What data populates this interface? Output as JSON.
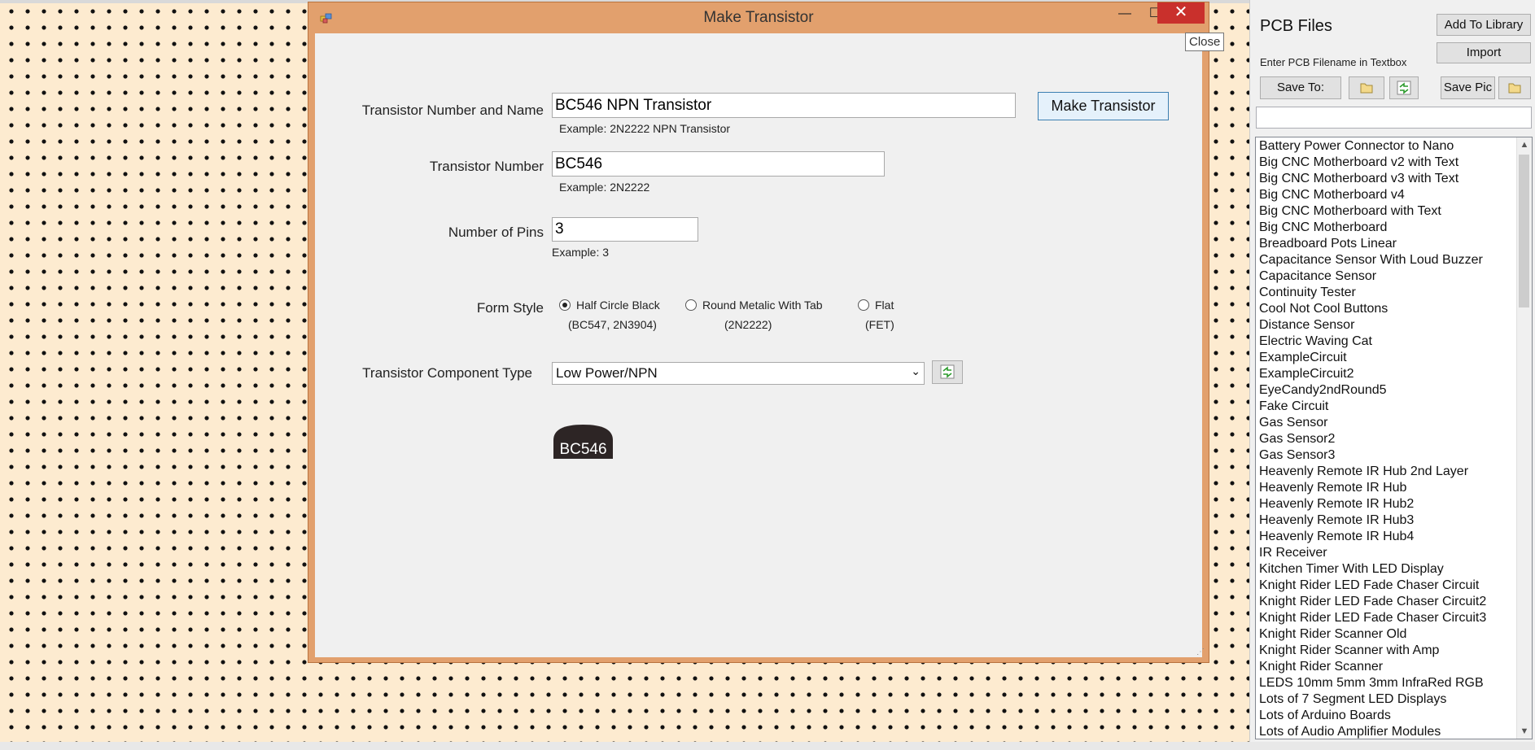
{
  "dialog": {
    "title": "Make Transistor",
    "minimize_glyph": "—",
    "maximize_glyph": "☐",
    "close_glyph": "✕",
    "close_tooltip": "Close",
    "name_label": "Transistor Number and Name",
    "name_value": "BC546 NPN Transistor",
    "name_hint": "Example: 2N2222 NPN Transistor",
    "make_button": "Make Transistor",
    "number_label": "Transistor Number",
    "number_value": "BC546",
    "number_hint": "Example: 2N2222",
    "pins_label": "Number of Pins",
    "pins_value": "3",
    "pins_hint": "Example: 3",
    "form_label": "Form Style",
    "form_options": [
      {
        "label": "Half Circle Black",
        "sub": "(BC547, 2N3904)",
        "selected": true
      },
      {
        "label": "Round Metalic With Tab",
        "sub": "(2N2222)",
        "selected": false
      },
      {
        "label": "Flat",
        "sub": "(FET)",
        "selected": false
      }
    ],
    "type_label": "Transistor Component Type",
    "type_value": "Low Power/NPN",
    "preview_text": "BC546"
  },
  "panel": {
    "title": "PCB Files",
    "add_library": "Add To Library",
    "import": "Import",
    "hint": "Enter PCB Filename in Textbox",
    "save_to": "Save To:",
    "save_pic": "Save Pic",
    "filename_value": "",
    "files": [
      "Battery Power Connector to Nano",
      "Big CNC Motherboard v2 with Text",
      "Big CNC Motherboard v3 with Text",
      "Big CNC Motherboard v4",
      "Big CNC Motherboard with Text",
      "Big CNC Motherboard",
      "Breadboard Pots Linear",
      "Capacitance Sensor With Loud Buzzer",
      "Capacitance Sensor",
      "Continuity Tester",
      "Cool Not Cool Buttons",
      "Distance Sensor",
      "Electric Waving Cat",
      "ExampleCircuit",
      "ExampleCircuit2",
      "EyeCandy2ndRound5",
      "Fake Circuit",
      "Gas Sensor",
      "Gas Sensor2",
      "Gas Sensor3",
      "Heavenly Remote IR Hub 2nd Layer",
      "Heavenly Remote IR Hub",
      "Heavenly Remote IR Hub2",
      "Heavenly Remote IR Hub3",
      "Heavenly Remote IR Hub4",
      "IR Receiver",
      "Kitchen Timer With LED Display",
      "Knight Rider LED Fade Chaser Circuit",
      "Knight Rider LED Fade Chaser Circuit2",
      "Knight Rider LED Fade Chaser Circuit3",
      "Knight Rider Scanner Old",
      "Knight Rider Scanner with Amp",
      "Knight Rider Scanner",
      "LEDS 10mm 5mm 3mm InfraRed RGB",
      "Lots of 7 Segment LED Displays",
      "Lots of Arduino Boards",
      "Lots of Audio Amplifier Modules"
    ]
  },
  "colors": {
    "board": "#fdebd0",
    "dialog_frame": "#e2a06d",
    "close_red": "#c9302c",
    "transistor_body": "#2d2525"
  }
}
